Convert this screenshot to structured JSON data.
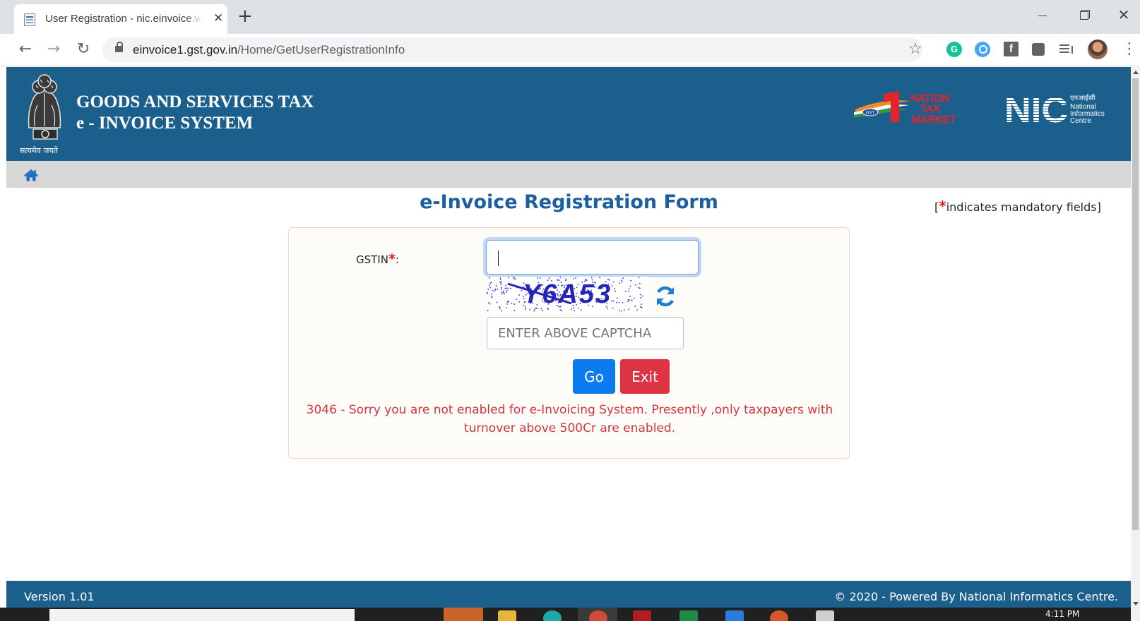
{
  "browser": {
    "tab_title": "User Registration - nic.einvoice.w",
    "url_domain": "einvoice1.gst.gov.in",
    "url_path": "/Home/GetUserRegistrationInfo"
  },
  "header": {
    "emblem_caption": "सत्यमेव जयते",
    "title": "GOODS AND SERVICES TAX",
    "subtitle": "e - INVOICE SYSTEM",
    "logo_ontm_lines": [
      "NATION",
      "TAX",
      "MARKET"
    ],
    "logo_ontm_badge": "GST",
    "logo_nic_text": "NIC",
    "logo_nic_hindi": "एनआईसी",
    "logo_nic_lines": [
      "National",
      "Informatics",
      "Centre"
    ]
  },
  "form": {
    "title": "e-Invoice Registration Form",
    "mandatory_star": "*",
    "mandatory_note": "indicates mandatory fields]",
    "mandatory_open": "[",
    "gstin_label": "GSTIN",
    "gstin_suffix": ":",
    "gstin_value": "",
    "captcha_text": "Y6A53",
    "captcha_placeholder": "ENTER ABOVE CAPTCHA",
    "go_label": "Go",
    "exit_label": "Exit",
    "error_message": "3046 - Sorry you are not enabled for e-Invoicing System. Presently ,only taxpayers with turnover above 500Cr are enabled."
  },
  "footer": {
    "version": "Version 1.01",
    "copyright": "© 2020 - Powered By National Informatics Centre."
  },
  "taskbar": {
    "clock": "4:11 PM"
  },
  "colors": {
    "header_bg": "#1b5f8d",
    "navbar_bg": "#d7d7d7",
    "title_blue": "#1b5f9f",
    "go_button": "#0d7bf0",
    "exit_button": "#dc3442",
    "error_red": "#d0363f",
    "required_star": "#e2171b"
  },
  "icons": {
    "home": "home-icon",
    "refresh": "refresh-icon",
    "lock": "lock-icon",
    "star": "bookmark-star-icon"
  }
}
